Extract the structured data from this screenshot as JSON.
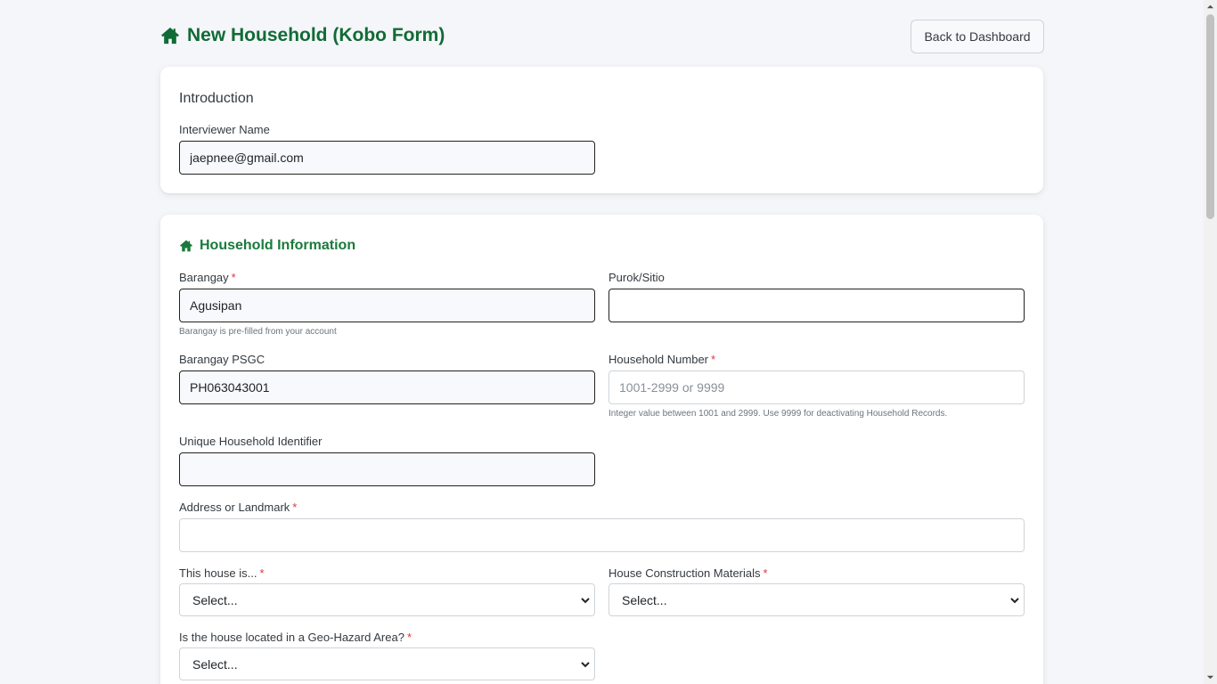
{
  "header": {
    "title": "New Household (Kobo Form)",
    "back_label": "Back to Dashboard"
  },
  "introduction": {
    "title": "Introduction",
    "interviewer_label": "Interviewer Name",
    "interviewer_value": "jaepnee@gmail.com"
  },
  "household": {
    "title": "Household Information",
    "barangay_label": "Barangay",
    "barangay_value": "Agusipan",
    "barangay_help": "Barangay is pre-filled from your account",
    "purok_label": "Purok/Sitio",
    "purok_value": "",
    "psgc_label": "Barangay PSGC",
    "psgc_value": "PH063043001",
    "household_number_label": "Household Number",
    "household_number_placeholder": "1001-2999 or 9999",
    "household_number_help": "Integer value between 1001 and 2999. Use 9999 for deactivating Household Records.",
    "uhid_label": "Unique Household Identifier",
    "uhid_value": "",
    "address_label": "Address or Landmark",
    "address_value": "",
    "house_is_label": "This house is...",
    "house_is_value": "Select...",
    "materials_label": "House Construction Materials",
    "materials_value": "Select...",
    "geohazard_label": "Is the house located in a Geo-Hazard Area?",
    "geohazard_value": "Select...",
    "required_mark": "*"
  },
  "colors": {
    "brand_green": "#116b36",
    "required_red": "#dc3545"
  },
  "icons": {
    "title_icon": "home-icon",
    "section_icon": "home-icon",
    "select_icon": "chevron-down-icon"
  }
}
